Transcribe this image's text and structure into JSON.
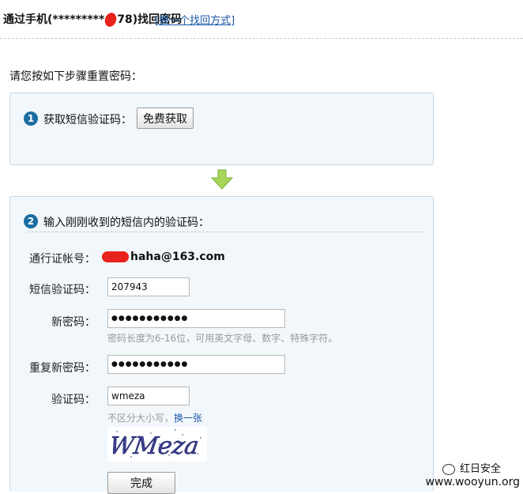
{
  "header": {
    "title_prefix": "通过手机(*********",
    "title_suffix": "78)找回密码",
    "switch_link": "[换一个找回方式]"
  },
  "intro": "请您按如下步骤重置密码：",
  "step1": {
    "number": "1",
    "label": "获取短信验证码：",
    "button": "免费获取"
  },
  "step2": {
    "number": "2",
    "label": "输入刚刚收到的短信内的验证码：",
    "account_label": "通行证帐号：",
    "account_value": "haha@163.com",
    "sms_label": "短信验证码：",
    "sms_value": "207943",
    "new_pw_label": "新密码：",
    "new_pw_value": "●●●●●●●●●●●",
    "pw_hint": "密码长度为6-16位，可用英文字母、数字、特殊字符。",
    "repeat_pw_label": "重复新密码：",
    "repeat_pw_value": "●●●●●●●●●●●",
    "captcha_label": "验证码：",
    "captcha_value": "wmeza",
    "captcha_hint": "不区分大小写，",
    "captcha_refresh": "换一张",
    "captcha_image_text": "WMeza",
    "submit": "完成"
  },
  "watermark": {
    "line1": "红日安全",
    "line2": "www.wooyun.org"
  },
  "colors": {
    "link": "#1a57a6",
    "panel_bg": "#f2f7fb",
    "step_badge": "#1c6da3",
    "redaction": "#e8231d",
    "arrow": "#8dc63f"
  }
}
